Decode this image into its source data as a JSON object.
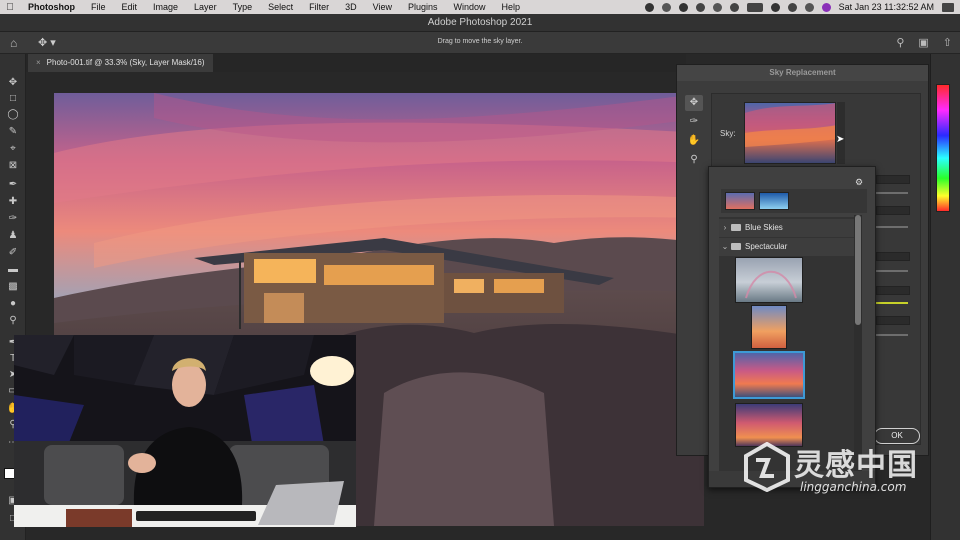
{
  "menubar": {
    "app": "Photoshop",
    "items": [
      "File",
      "Edit",
      "Image",
      "Layer",
      "Type",
      "Select",
      "Filter",
      "3D",
      "View",
      "Plugins",
      "Window",
      "Help"
    ],
    "clock": "Sat Jan 23  11:32:52 AM"
  },
  "window": {
    "title": "Adobe Photoshop 2021"
  },
  "options_bar": {
    "hint": "Drag to move the sky layer."
  },
  "document": {
    "tab_label": "Photo-001.tif @ 33.3% (Sky, Layer Mask/16)"
  },
  "dialog": {
    "title": "Sky Replacement",
    "sky_label": "Sky:",
    "ok_label": "OK"
  },
  "sky_presets": {
    "folders": [
      {
        "name": "Blue Skies",
        "expanded": false
      },
      {
        "name": "Spectacular",
        "expanded": true
      }
    ],
    "selected_index": 2
  },
  "watermark": {
    "chinese": "灵感中国",
    "english": "lingganchina.com"
  },
  "colors": {
    "selection": "#3d9ad6",
    "panel": "#3c3c3c",
    "menubar": "#d9d6d6"
  }
}
